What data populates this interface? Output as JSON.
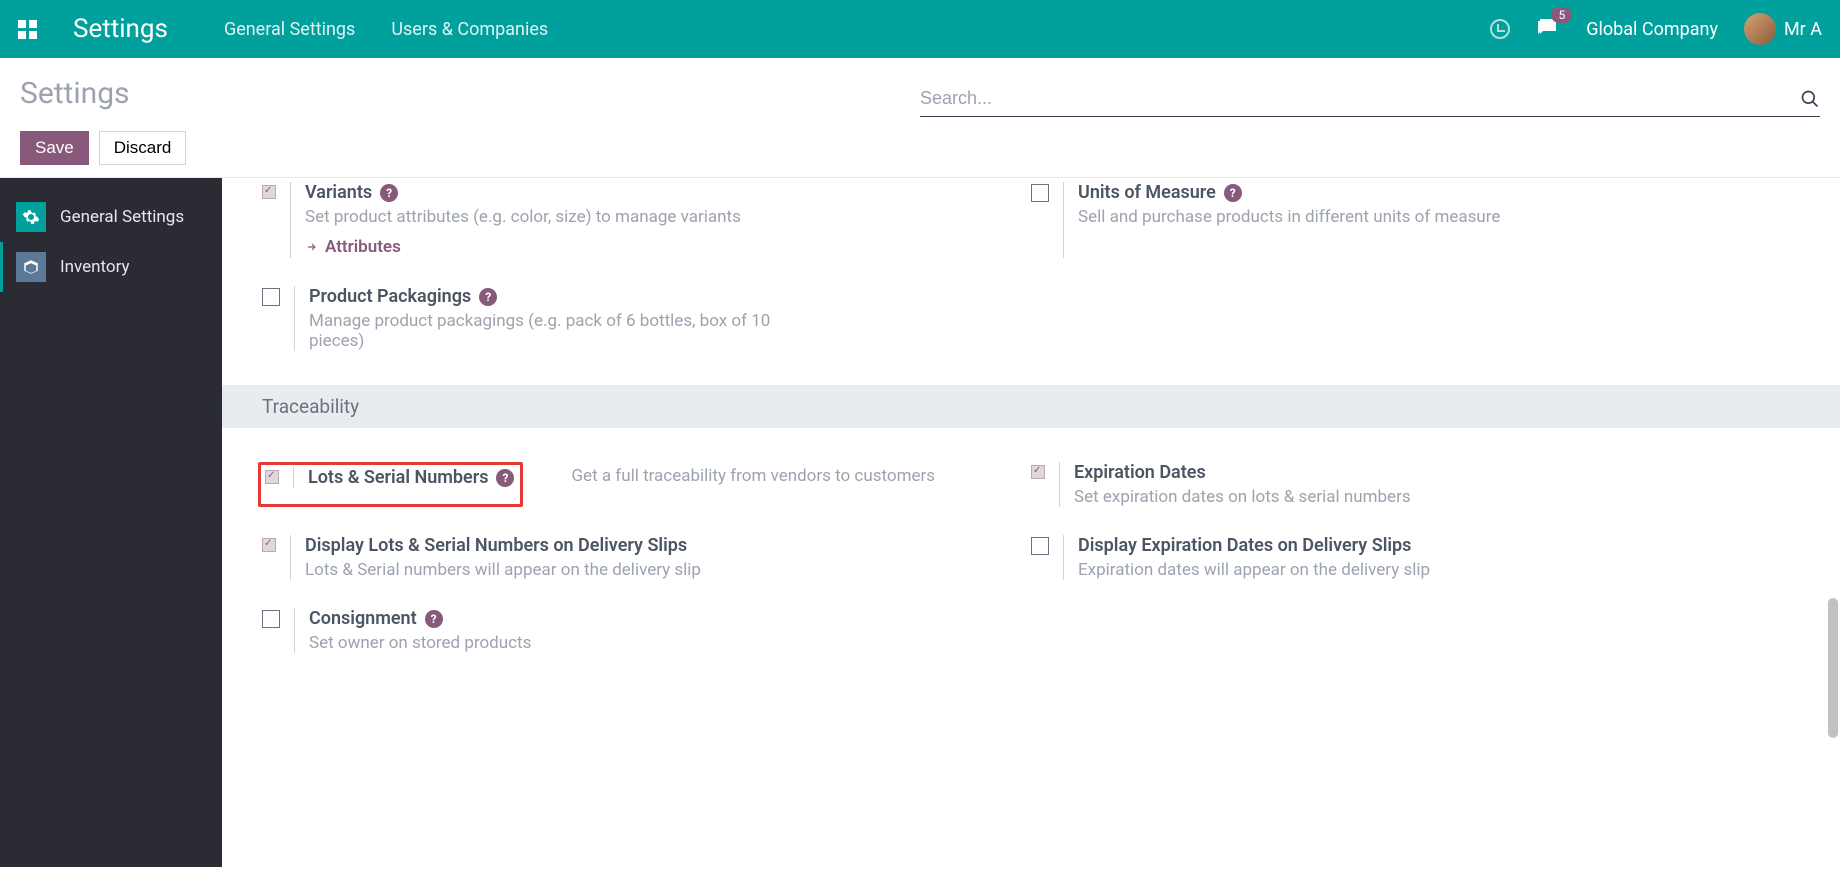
{
  "navbar": {
    "title": "Settings",
    "menu": [
      "General Settings",
      "Users & Companies"
    ],
    "badge_count": "5",
    "company": "Global Company",
    "user_name": "Mr A"
  },
  "subheader": {
    "title": "Settings",
    "save": "Save",
    "discard": "Discard",
    "search_placeholder": "Search..."
  },
  "sidebar": {
    "items": [
      {
        "label": "General Settings"
      },
      {
        "label": "Inventory"
      }
    ]
  },
  "sections": {
    "products": {
      "variants": {
        "title": "Variants",
        "desc": "Set product attributes (e.g. color, size) to manage variants",
        "link": "Attributes"
      },
      "uom": {
        "title": "Units of Measure",
        "desc": "Sell and purchase products in different units of measure"
      },
      "packagings": {
        "title": "Product Packagings",
        "desc": "Manage product packagings (e.g. pack of 6 bottles, box of 10 pieces)"
      }
    },
    "traceability_header": "Traceability",
    "traceability": {
      "lots": {
        "title": "Lots & Serial Numbers",
        "desc": "Get a full traceability from vendors to customers"
      },
      "expiration": {
        "title": "Expiration Dates",
        "desc": "Set expiration dates on lots & serial numbers"
      },
      "display_lots": {
        "title": "Display Lots & Serial Numbers on Delivery Slips",
        "desc": "Lots & Serial numbers will appear on the delivery slip"
      },
      "display_exp": {
        "title": "Display Expiration Dates on Delivery Slips",
        "desc": "Expiration dates will appear on the delivery slip"
      },
      "consignment": {
        "title": "Consignment",
        "desc": "Set owner on stored products"
      }
    }
  }
}
